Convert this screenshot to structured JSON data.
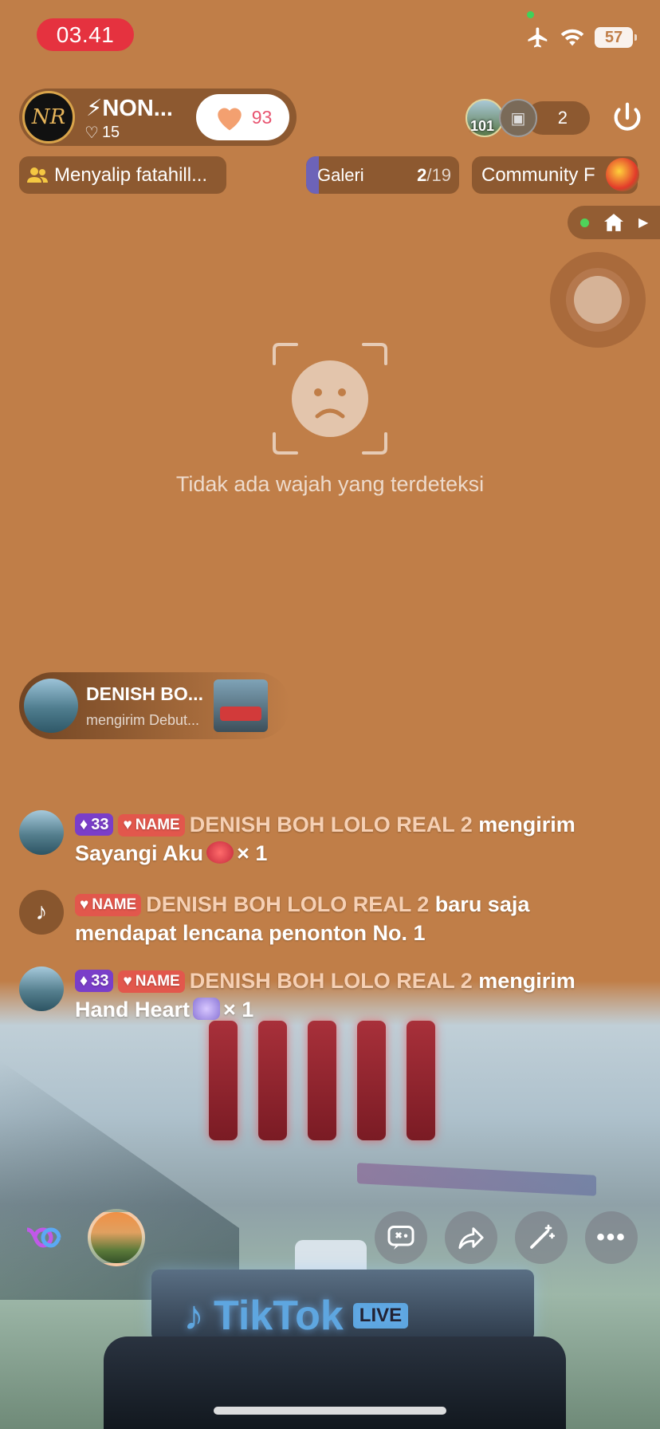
{
  "status_bar": {
    "time": "03.41",
    "battery": "57"
  },
  "host": {
    "avatar_text": "NR",
    "name": "⚡NON...",
    "likes": "15",
    "follow_count": "93"
  },
  "viewers": {
    "avatar1_badge": "101",
    "count": "2"
  },
  "pills": {
    "rank_text": "Menyalip fatahill...",
    "galeri_label": "Galeri",
    "galeri_current": "2",
    "galeri_total": "/19",
    "community_label": "Community F"
  },
  "face_detection": {
    "message": "Tidak ada wajah yang terdeteksi"
  },
  "gift_toast": {
    "name": "DENISH BO...",
    "subtitle": "mengirim Debut..."
  },
  "comments": [
    {
      "level": "33",
      "badge": "NAME",
      "user": "DENISH BOH LOLO REAL 2",
      "text_before": "mengirim",
      "text_line2": "Sayangi Aku",
      "count": "× 1"
    },
    {
      "badge": "NAME",
      "user": "DENISH BOH LOLO REAL 2",
      "text_before": "baru saja",
      "text_line2": "mendapat lencana penonton No. 1"
    },
    {
      "level": "33",
      "badge": "NAME",
      "user": "DENISH BOH LOLO REAL 2",
      "text_before": "mengirim",
      "text_line2": "Hand Heart",
      "count": "× 1"
    }
  ],
  "scene": {
    "logo": "TikTok",
    "live": "LIVE"
  },
  "bottom_bar": {
    "more": "•••"
  },
  "colors": {
    "background": "#c07e48",
    "time_pill": "#e5323f",
    "name_badge": "#e2574c",
    "level_badge": "#7a3ec9"
  }
}
